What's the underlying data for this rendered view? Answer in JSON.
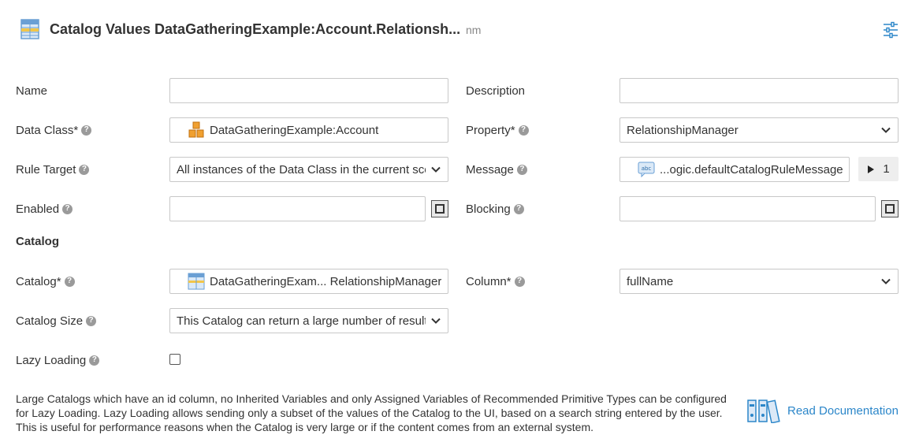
{
  "header": {
    "title": "Catalog Values DataGatheringExample:Account.Relationsh...",
    "subtitle": "nm"
  },
  "fields": {
    "name_label": "Name",
    "description_label": "Description",
    "data_class_label": "Data Class*",
    "data_class_value": "DataGatheringExample:Account",
    "property_label": "Property*",
    "property_value": "RelationshipManager",
    "rule_target_label": "Rule Target",
    "rule_target_value": "All instances of the Data Class in the current scope",
    "message_label": "Message",
    "message_value": "...ogic.defaultCatalogRuleMessage",
    "message_count": "1",
    "enabled_label": "Enabled",
    "blocking_label": "Blocking"
  },
  "catalog": {
    "section_title": "Catalog",
    "catalog_label": "Catalog*",
    "catalog_value": "DataGatheringExam... RelationshipManagers",
    "column_label": "Column*",
    "column_value": "fullName",
    "size_label": "Catalog Size",
    "size_value": "This Catalog can return a large number of results",
    "lazy_label": "Lazy Loading",
    "info_text": "Large Catalogs which have an id column, no Inherited Variables and only Assigned Variables of Recommended Primitive Types can be configured for Lazy Loading. Lazy Loading allows sending only a subset of the values of the Catalog to the UI, based on a search string entered by the user. This is useful for performance reasons when the Catalog is very large or if the content comes from an external system."
  },
  "documentation": {
    "link_label": "Read Documentation"
  },
  "colors": {
    "accent": "#2b86c9",
    "border": "#c8c8c8",
    "help_icon": "#9a9a9a"
  }
}
